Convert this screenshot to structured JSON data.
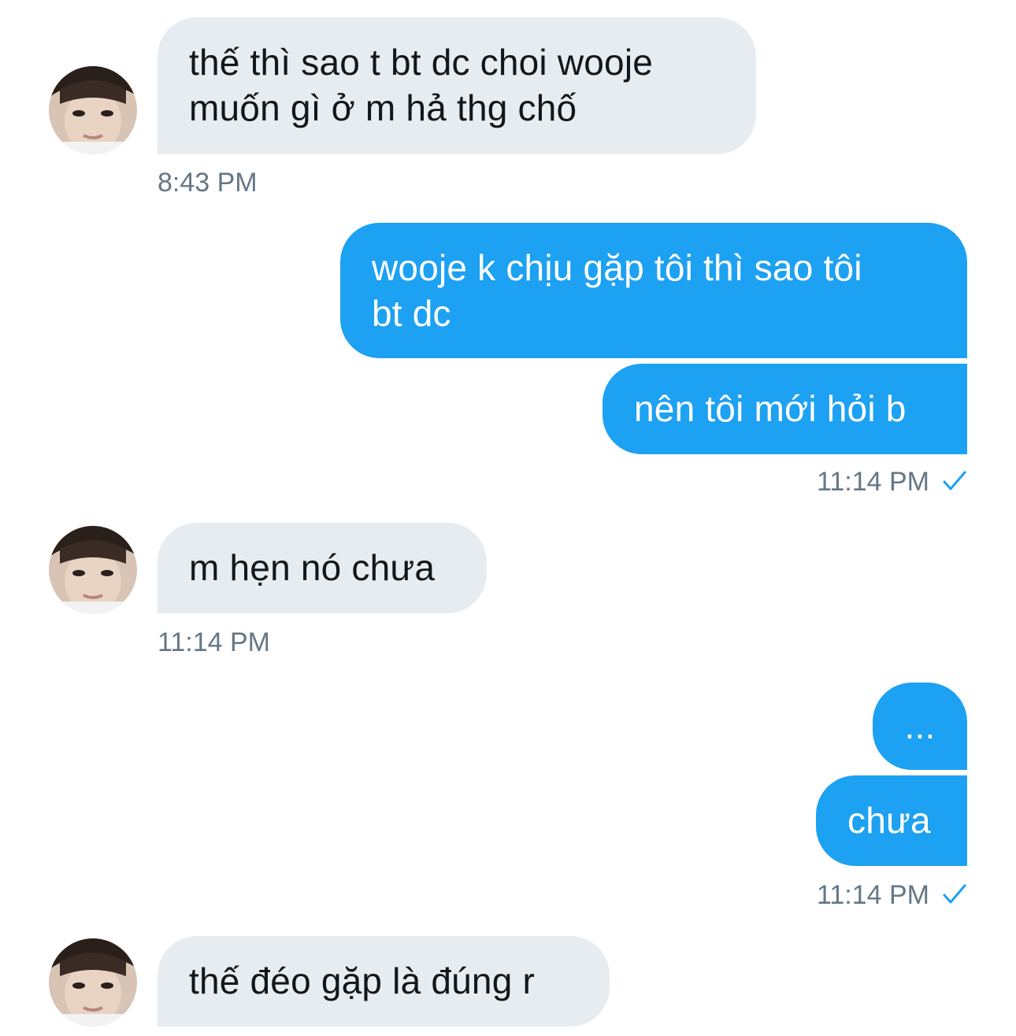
{
  "conversation": {
    "messages": [
      {
        "side": "incoming",
        "text": "thế thì sao t bt dc choi wooje\nmuốn gì ở m hả thg chố"
      },
      {
        "side": "outgoing",
        "text": "wooje k chịu gặp tôi thì sao tôi\nbt dc"
      },
      {
        "side": "outgoing",
        "text": "nên tôi mới hỏi b"
      },
      {
        "side": "incoming",
        "text": "m hẹn nó chưa"
      },
      {
        "side": "outgoing",
        "text": "..."
      },
      {
        "side": "outgoing",
        "text": "chưa"
      },
      {
        "side": "incoming",
        "text": "thế đéo gặp là đúng r"
      }
    ],
    "timestamps": [
      {
        "text": "8:43 PM",
        "read_check": false
      },
      {
        "text": "11:14 PM",
        "read_check": true
      },
      {
        "text": "11:14 PM",
        "read_check": false
      },
      {
        "text": "11:14 PM",
        "read_check": true
      }
    ]
  },
  "colors": {
    "outgoing_bubble": "#1da1f2",
    "incoming_bubble": "#e6ecf0",
    "timestamp": "#657786",
    "check": "#1da1f2"
  },
  "icons": {
    "avatar": "user-avatar-photo",
    "read_receipt": "check-icon"
  }
}
